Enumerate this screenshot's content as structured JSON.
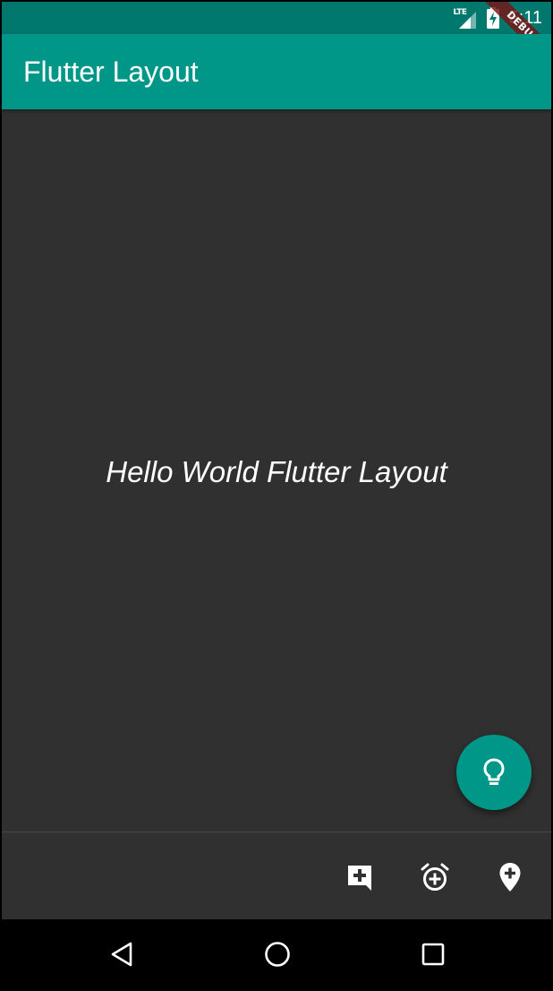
{
  "status_bar": {
    "network_label": "LTE",
    "time": "5:11",
    "icons": [
      "lte-signal-icon",
      "battery-charging-icon"
    ]
  },
  "debug_banner": {
    "label": "DEBUG"
  },
  "app_bar": {
    "title": "Flutter Layout"
  },
  "body": {
    "text": "Hello World Flutter Layout"
  },
  "fab": {
    "icon": "lightbulb-outline-icon"
  },
  "bottom_bar": {
    "actions": [
      {
        "icon": "add-comment-icon"
      },
      {
        "icon": "add-alarm-icon"
      },
      {
        "icon": "add-location-icon"
      }
    ]
  },
  "nav_bar": {
    "buttons": [
      {
        "icon": "back-triangle-icon"
      },
      {
        "icon": "home-circle-icon"
      },
      {
        "icon": "recents-square-icon"
      }
    ]
  },
  "colors": {
    "primary": "#009688",
    "status_bar": "#00786d",
    "background": "#303030",
    "debug_banner": "#781414",
    "nav_bar": "#000000",
    "text": "#ffffff"
  }
}
